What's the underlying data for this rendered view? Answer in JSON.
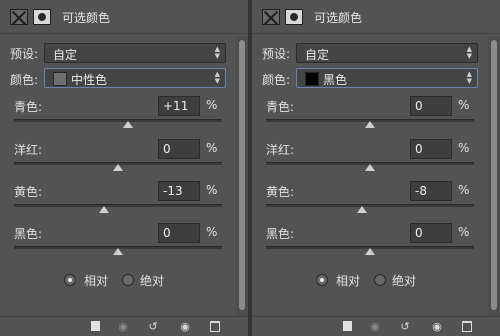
{
  "panels": [
    {
      "title": "可选颜色",
      "preset_label": "预设:",
      "preset_value": "自定",
      "colors_label": "颜色:",
      "colors_value": "中性色",
      "swatch_color": "#6e6e6e",
      "sliders": [
        {
          "label": "青色:",
          "value": "+11",
          "unit": "%",
          "level_pct": 55
        },
        {
          "label": "洋红:",
          "value": "0",
          "unit": "%",
          "level_pct": 50
        },
        {
          "label": "黄色:",
          "value": "-13",
          "unit": "%",
          "level_pct": 43.5
        },
        {
          "label": "黑色:",
          "value": "0",
          "unit": "%",
          "level_pct": 50
        }
      ],
      "method": {
        "relative_label": "相对",
        "absolute_label": "绝对",
        "selected": "relative"
      }
    },
    {
      "title": "可选颜色",
      "preset_label": "预设:",
      "preset_value": "自定",
      "colors_label": "颜色:",
      "colors_value": "黑色",
      "swatch_color": "#000000",
      "sliders": [
        {
          "label": "青色:",
          "value": "0",
          "unit": "%",
          "level_pct": 50
        },
        {
          "label": "洋红:",
          "value": "0",
          "unit": "%",
          "level_pct": 50
        },
        {
          "label": "黄色:",
          "value": "-8",
          "unit": "%",
          "level_pct": 46
        },
        {
          "label": "黑色:",
          "value": "0",
          "unit": "%",
          "level_pct": 50
        }
      ],
      "method": {
        "relative_label": "相对",
        "absolute_label": "绝对",
        "selected": "relative"
      }
    }
  ],
  "footer_icons": [
    "clip-to-layer-icon",
    "view-previous-state-icon",
    "reset-icon",
    "visibility-eye-icon",
    "delete-trash-icon"
  ],
  "colors": {
    "panel_bg": "#535353",
    "field_bg": "#444444",
    "focus_border": "#6d84a8",
    "text": "#e2e2e2"
  }
}
